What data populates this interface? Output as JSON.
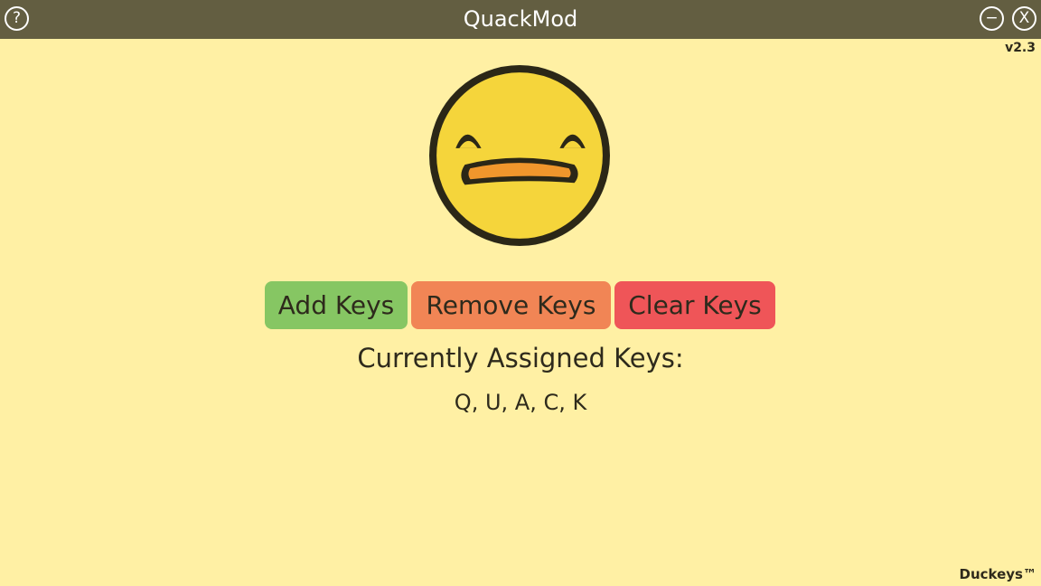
{
  "window": {
    "title": "QuackMod",
    "help_label": "?",
    "minimize_label": "−",
    "close_label": "X",
    "version": "v2.3"
  },
  "icons": {
    "logo": "duck-face-icon",
    "help": "question-mark-icon",
    "minimize": "minimize-icon",
    "close": "close-icon"
  },
  "actions": {
    "add_label": "Add Keys",
    "remove_label": "Remove Keys",
    "clear_label": "Clear Keys"
  },
  "assigned": {
    "label": "Currently Assigned Keys:",
    "keys": "Q, U, A, C, K"
  },
  "footer": {
    "brand": "Duckeys™"
  },
  "colors": {
    "background": "#fff0a4",
    "titlebar": "#635e41",
    "add_button": "#86c663",
    "remove_button": "#f18555",
    "clear_button": "#ef5558",
    "duck_face": "#f5d53b",
    "duck_beak": "#f0962c"
  }
}
